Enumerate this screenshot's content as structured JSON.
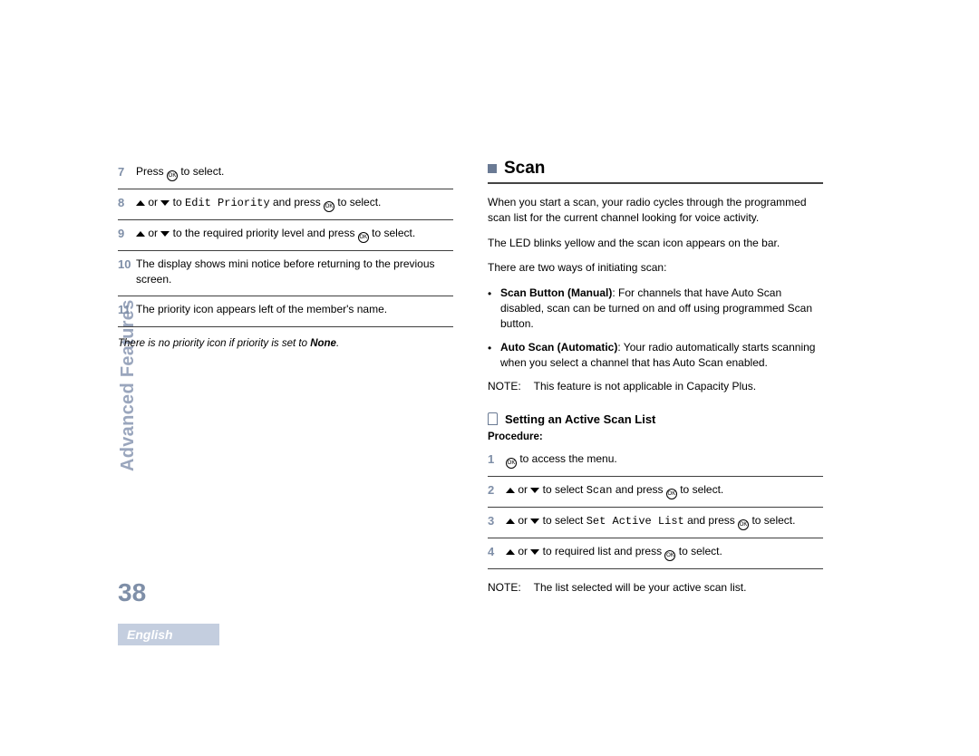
{
  "side_label": "Advanced Features",
  "page_number": "38",
  "language": "English",
  "left": {
    "steps": [
      {
        "n": "7",
        "before": "Press ",
        "icon": "ok",
        "after": " to select."
      },
      {
        "n": "8",
        "arrows": true,
        "mid": " to ",
        "mono": "Edit Priority",
        "after1": " and press ",
        "icon": "ok",
        "after2": " to select."
      },
      {
        "n": "9",
        "arrows": true,
        "mid": " to the required priority level and press ",
        "icon": "ok",
        "after2": " to select."
      },
      {
        "n": "10",
        "plain": "The display shows mini notice before returning to the previous screen."
      },
      {
        "n": "11",
        "plain": "The priority icon appears left of the member's name."
      }
    ],
    "note_before": "There is no priority icon if priority is set to ",
    "note_bold": "None",
    "note_after": "."
  },
  "right": {
    "section_title": "Scan",
    "p1": "When you start a scan, your radio cycles through the programmed scan list for the current channel looking for voice activity.",
    "p2": "The LED blinks yellow and the scan icon appears on the bar.",
    "p3": "There are two ways of initiating scan:",
    "bullets": [
      {
        "bold": "Scan Button (Manual)",
        "rest": ": For channels that have Auto Scan disabled, scan can be turned on and off using programmed Scan button."
      },
      {
        "bold": "Auto Scan (Automatic)",
        "rest": ": Your radio automatically starts scanning when you select a channel that has Auto Scan enabled."
      }
    ],
    "note1_label": "NOTE:",
    "note1_body": "This feature is not applicable in Capacity Plus.",
    "subhead": "Setting an Active Scan List",
    "procedure": "Procedure:",
    "proc_steps": [
      {
        "n": "1",
        "icon": "ok",
        "after": " to access the menu."
      },
      {
        "n": "2",
        "arrows": true,
        "mid": " to select ",
        "mono": "Scan",
        "after1": " and press ",
        "icon2": "ok",
        "after2": " to select."
      },
      {
        "n": "3",
        "arrows": true,
        "mid": " to select ",
        "mono": "Set Active List",
        "after1": " and press ",
        "icon2": "ok",
        "after2": " to select."
      },
      {
        "n": "4",
        "arrows": true,
        "mid": " to required list and press ",
        "icon2": "ok",
        "after2": " to select."
      }
    ],
    "note2_label": "NOTE:",
    "note2_body": "The list selected will be your active scan list."
  }
}
